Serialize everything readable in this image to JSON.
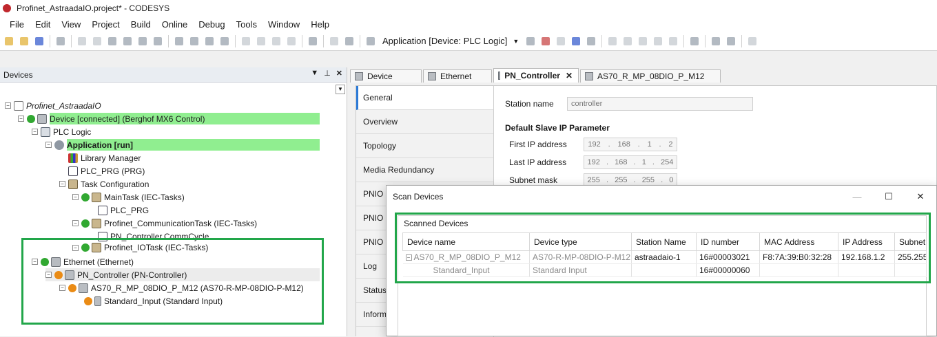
{
  "window": {
    "title": "Profinet_AstraadaIO.project* - CODESYS"
  },
  "menu": [
    "File",
    "Edit",
    "View",
    "Project",
    "Build",
    "Online",
    "Debug",
    "Tools",
    "Window",
    "Help"
  ],
  "toolbar": {
    "application_selector": "Application [Device: PLC Logic]"
  },
  "devices_panel": {
    "title": "Devices",
    "tree": [
      {
        "label": "Profinet_AstraadaIO",
        "icon": "project-icon"
      },
      {
        "label": "Device [connected] (Berghof MX6 Control)",
        "icon": "device-icon",
        "status": "green"
      },
      {
        "label": "PLC Logic",
        "icon": "plc-logic-icon"
      },
      {
        "label": "Application [run]",
        "icon": "application-icon"
      },
      {
        "label": "Library Manager",
        "icon": "library-icon"
      },
      {
        "label": "PLC_PRG (PRG)",
        "icon": "program-icon"
      },
      {
        "label": "Task Configuration",
        "icon": "task-config-icon"
      },
      {
        "label": "MainTask (IEC-Tasks)",
        "icon": "task-icon",
        "status": "green"
      },
      {
        "label": "PLC_PRG",
        "icon": "program-icon"
      },
      {
        "label": "Profinet_CommunicationTask (IEC-Tasks)",
        "icon": "task-icon",
        "status": "green"
      },
      {
        "label": "PN_Controller.CommCycle",
        "icon": "program-icon"
      },
      {
        "label": "Profinet_IOTask (IEC-Tasks)",
        "icon": "task-icon",
        "status": "green"
      },
      {
        "label": "Ethernet (Ethernet)",
        "icon": "ethernet-icon",
        "status": "green"
      },
      {
        "label": "PN_Controller (PN-Controller)",
        "icon": "pn-controller-icon",
        "status": "orange"
      },
      {
        "label": "AS70_R_MP_08DIO_P_M12 (AS70-R-MP-08DIO-P-M12)",
        "icon": "io-device-icon",
        "status": "orange"
      },
      {
        "label": "Standard_Input (Standard Input)",
        "icon": "module-icon",
        "status": "orange"
      }
    ]
  },
  "editor": {
    "tabs": [
      "Device",
      "Ethernet",
      "PN_Controller",
      "AS70_R_MP_08DIO_P_M12"
    ],
    "side_tabs": [
      "General",
      "Overview",
      "Topology",
      "Media Redundancy",
      "PNIO I",
      "PNIO I",
      "PNIO P",
      "Log",
      "Status",
      "Inform"
    ],
    "general": {
      "station_name_label": "Station name",
      "station_name_value": "controller",
      "default_slave_title": "Default Slave IP Parameter",
      "first_ip_label": "First IP address",
      "first_ip": [
        "192",
        "168",
        "1",
        "2"
      ],
      "last_ip_label": "Last IP address",
      "last_ip": [
        "192",
        "168",
        "1",
        "254"
      ],
      "subnet_label": "Subnet mask",
      "subnet": [
        "255",
        "255",
        "255",
        "0"
      ]
    }
  },
  "scan_dialog": {
    "title": "Scan Devices",
    "group_label": "Scanned Devices",
    "columns": [
      "Device name",
      "Device type",
      "Station Name",
      "ID number",
      "MAC Address",
      "IP Address",
      "Subnet"
    ],
    "rows": [
      [
        "AS70_R_MP_08DIO_P_M12",
        "AS70-R-MP-08DIO-P-M12",
        "astraadaio-1",
        "16#00003021",
        "F8:7A:39:B0:32:28",
        "192.168.1.2",
        "255.255"
      ],
      [
        "Standard_Input",
        "Standard Input",
        "",
        "16#00000060",
        "",
        "",
        ""
      ]
    ]
  },
  "colors": {
    "highlight_green": "#90ee90",
    "annotation_box": "#22a64a",
    "status_green": "#31a831",
    "status_orange": "#ea8b15"
  }
}
